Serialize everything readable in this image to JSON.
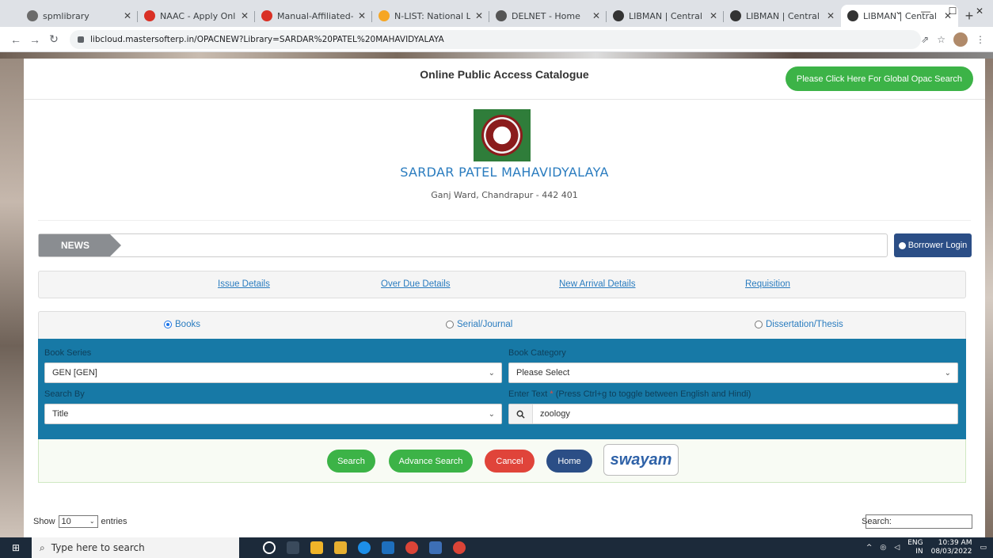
{
  "browser": {
    "tabs": [
      {
        "label": "spmlibrary",
        "color": "#6b6b6b",
        "active": false
      },
      {
        "label": "NAAC - Apply Onli",
        "color": "#d93025",
        "active": false
      },
      {
        "label": "Manual-Affiliated-",
        "color": "#d93025",
        "active": false
      },
      {
        "label": "N-LIST: National Li",
        "color": "#f6a623",
        "active": false
      },
      {
        "label": "DELNET - Home",
        "color": "#555555",
        "active": false
      },
      {
        "label": "LIBMAN | Central L",
        "color": "#333333",
        "active": false
      },
      {
        "label": "LIBMAN | Central L",
        "color": "#333333",
        "active": false
      },
      {
        "label": "LIBMAN | Central L",
        "color": "#333333",
        "active": true
      }
    ],
    "url": "libcloud.mastersofterp.in/OPACNEW?Library=SARDAR%20PATEL%20MAHAVIDYALAYA"
  },
  "header": {
    "title": "Online Public Access Catalogue",
    "global_btn": "Please Click Here For Global Opac Search"
  },
  "college": {
    "name": "SARDAR PATEL MAHAVIDYALAYA",
    "address": "Ganj Ward, Chandrapur - 442 401"
  },
  "news": {
    "label": "NEWS",
    "borrower_login": "Borrower Login"
  },
  "links": [
    "Issue Details",
    "Over Due Details",
    "New Arrival Details",
    "Requisition"
  ],
  "types": [
    {
      "label": "Books",
      "selected": true
    },
    {
      "label": "Serial/Journal",
      "selected": false
    },
    {
      "label": "Dissertation/Thesis",
      "selected": false
    }
  ],
  "form": {
    "book_series_label": "Book Series",
    "book_series_value": "GEN [GEN]",
    "book_category_label": "Book Category",
    "book_category_value": "Please Select",
    "search_by_label": "Search By",
    "search_by_value": "Title",
    "enter_text_label": "Enter Text",
    "enter_text_star": "*",
    "enter_text_hint": "(Press Ctrl+g to toggle between English and Hindi)",
    "enter_text_value": "zoology"
  },
  "buttons": {
    "search": "Search",
    "advance": "Advance Search",
    "cancel": "Cancel",
    "home": "Home",
    "swayam": "swayam"
  },
  "table": {
    "show": "Show",
    "length": "10",
    "entries": "entries",
    "search_label": "Search:"
  },
  "taskbar": {
    "search_placeholder": "Type here to search",
    "lang": "ENG",
    "region": "IN",
    "time": "10:39 AM",
    "date": "08/03/2022"
  },
  "colors": {
    "primary_blue": "#1779a6",
    "green": "#3cb347",
    "red": "#e0443a",
    "navy": "#2b4e86"
  }
}
